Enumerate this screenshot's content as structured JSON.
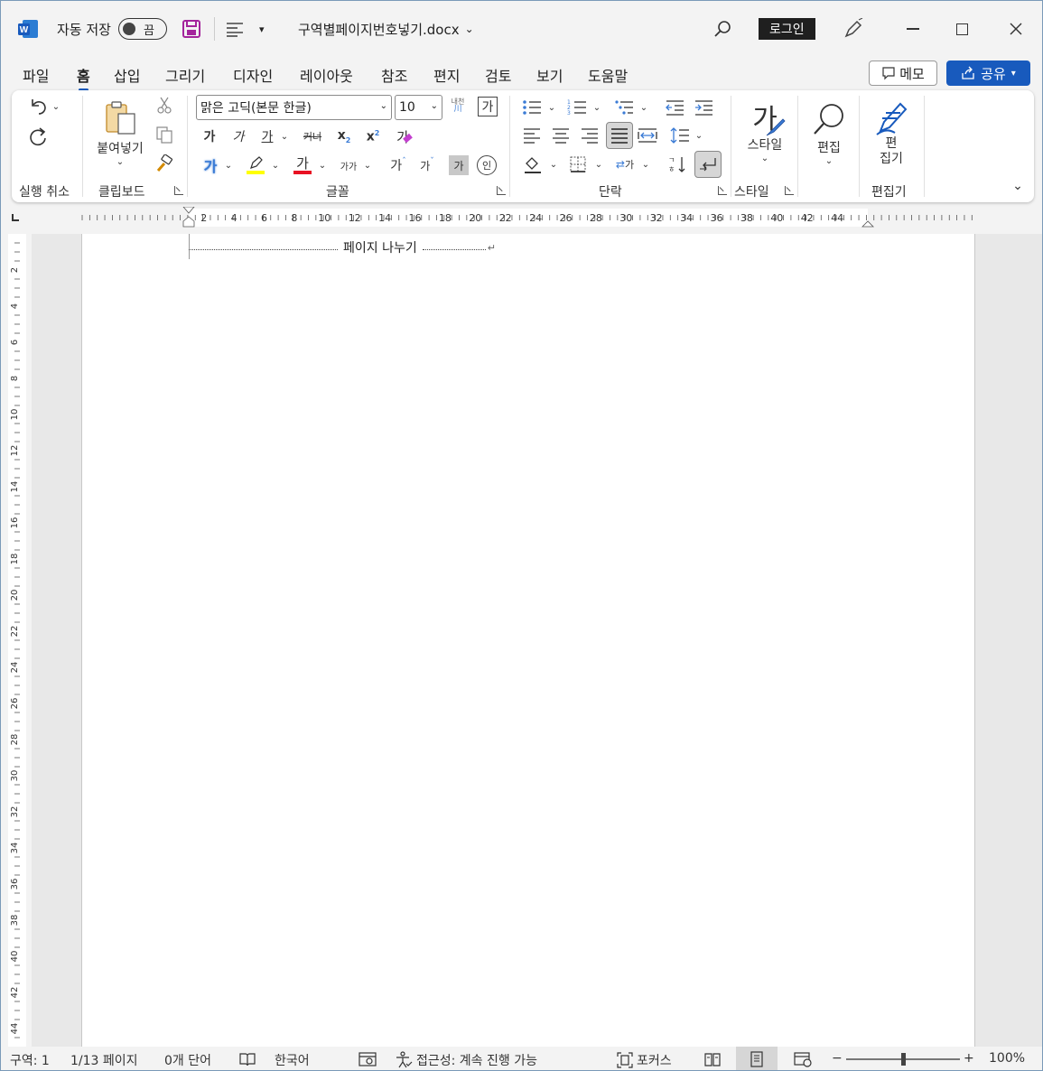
{
  "titlebar": {
    "autosave_label": "자동 저장",
    "autosave_state": "끔",
    "doc_title": "구역별페이지번호넣기.docx",
    "login_label": "로그인",
    "icons": [
      "word-logo-icon",
      "save-icon",
      "layout-icon",
      "customize-qat-icon",
      "search-icon",
      "pen-icon",
      "minimize-icon",
      "maximize-icon",
      "close-icon"
    ]
  },
  "tabs": [
    "파일",
    "홈",
    "삽입",
    "그리기",
    "디자인",
    "레이아웃",
    "참조",
    "편지",
    "검토",
    "보기",
    "도움말"
  ],
  "active_tab": "홈",
  "memo_label": "메모",
  "share_label": "공유",
  "ribbon": {
    "undo_group": "실행 취소",
    "clipboard_group": "클립보드",
    "paste_label": "붙여넣기",
    "font_group": "글꼴",
    "font_name": "맑은 고딕(본문 한글)",
    "font_size": "10",
    "font_glyph": "가",
    "italic_glyph": "가",
    "underline_glyph": "가",
    "strike_glyph": "커너",
    "small_glyph": "가가",
    "shade_glyph": "가",
    "circle_glyph": "인",
    "phonetic_glyph": "내천",
    "phonetic_sub": "川",
    "paragraph_group": "단락",
    "styles_group": "스타일",
    "styles_label": "스타일",
    "edit_label": "편집",
    "editor_group": "편집기",
    "editor_label_1": "편",
    "editor_label_2": "집기"
  },
  "document": {
    "page_break_label": "페이지 나누기"
  },
  "ruler": {
    "h_numbers": [
      "2",
      "4",
      "6",
      "8",
      "10",
      "12",
      "14",
      "16",
      "18",
      "20",
      "22",
      "24",
      "26",
      "28",
      "30",
      "32",
      "34",
      "36",
      "38",
      "40",
      "42",
      "44"
    ],
    "v_numbers": [
      "2",
      "4",
      "6",
      "8",
      "10",
      "12",
      "14",
      "16",
      "18",
      "20",
      "22",
      "24",
      "26",
      "28",
      "30",
      "32",
      "34",
      "36",
      "38",
      "40",
      "42",
      "44"
    ]
  },
  "status": {
    "section": "구역: 1",
    "page": "1/13 페이지",
    "words": "0개 단어",
    "language": "한국어",
    "accessibility": "접근성: 계속 진행 가능",
    "focus": "포커스",
    "zoom_minus": "−",
    "zoom_plus": "+",
    "zoom": "100%"
  },
  "colors": {
    "accent": "#185abd",
    "highlight": "#ffff00",
    "font_color": "#e81123"
  }
}
